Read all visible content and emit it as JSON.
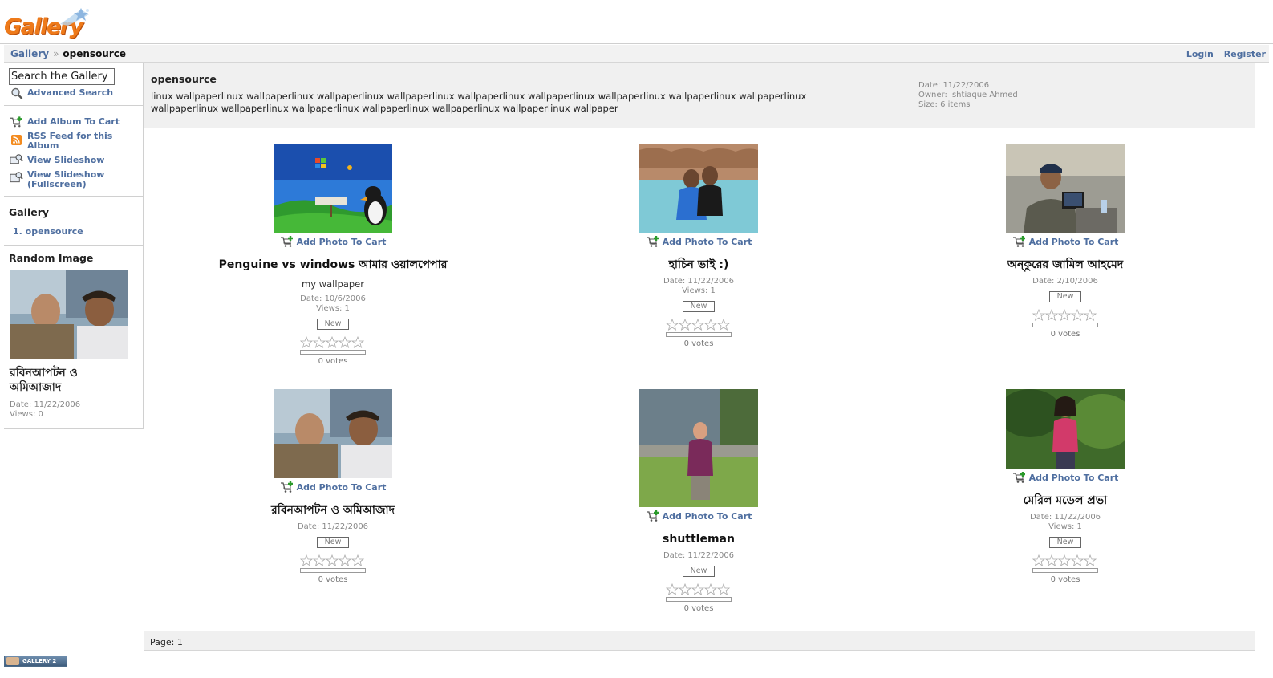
{
  "header": {
    "logo_text": "Gallery"
  },
  "breadcrumb": {
    "root": "Gallery",
    "separator": "»",
    "current": "opensource"
  },
  "auth": {
    "login": "Login",
    "register": "Register"
  },
  "sidebar": {
    "search_placeholder": "Search the Gallery",
    "advanced_search": "Advanced Search",
    "actions": {
      "add_album_to_cart": "Add Album To Cart",
      "rss_feed": "RSS Feed for this Album",
      "view_slideshow": "View Slideshow",
      "view_slideshow_full": "View Slideshow (Fullscreen)"
    },
    "gallery_heading": "Gallery",
    "gallery_path": "1. opensource",
    "random_heading": "Random Image",
    "random_image": {
      "title": "রবিনআপটন ও অমিআজাদ",
      "date": "Date: 11/22/2006",
      "views": "Views: 0"
    }
  },
  "album": {
    "title": "opensource",
    "description": "linux wallpaperlinux wallpaperlinux wallpaperlinux wallpaperlinux wallpaperlinux wallpaperlinux wallpaperlinux wallpaperlinux wallpaperlinux wallpaperlinux wallpaperlinux wallpaperlinux wallpaperlinux wallpaperlinux wallpaperlinux wallpaper",
    "date": "Date: 11/22/2006",
    "owner": "Owner: Ishtiaque Ahmed",
    "size": "Size: 6 items"
  },
  "items": [
    {
      "cart": "Add Photo To Cart",
      "title": "Penguine vs windows আমার ওয়ালপেপার",
      "summary": "my wallpaper",
      "date": "Date: 10/6/2006",
      "views": "Views: 1",
      "badge": "New",
      "votes": "0 votes"
    },
    {
      "cart": "Add Photo To Cart",
      "title": "হাচিন ভাই :)",
      "date": "Date: 11/22/2006",
      "views": "Views: 1",
      "badge": "New",
      "votes": "0 votes"
    },
    {
      "cart": "Add Photo To Cart",
      "title": "অন্কুরের জামিল আহমেদ",
      "date": "Date: 2/10/2006",
      "badge": "New",
      "votes": "0 votes"
    },
    {
      "cart": "Add Photo To Cart",
      "title": "রবিনআপটন ও অমিআজাদ",
      "date": "Date: 11/22/2006",
      "badge": "New",
      "votes": "0 votes"
    },
    {
      "cart": "Add Photo To Cart",
      "title": "shuttleman",
      "date": "Date: 11/22/2006",
      "badge": "New",
      "votes": "0 votes"
    },
    {
      "cart": "Add Photo To Cart",
      "title": "মেরিল মডেল প্রভা",
      "date": "Date: 11/22/2006",
      "views": "Views: 1",
      "badge": "New",
      "votes": "0 votes"
    }
  ],
  "pager": {
    "text": "Page: 1"
  },
  "footer": {
    "badge": "GALLERY 2"
  },
  "colors": {
    "link": "#4f6fa0",
    "logo_orange": "#ee7a1a",
    "panel_bg": "#f0f0f0"
  }
}
